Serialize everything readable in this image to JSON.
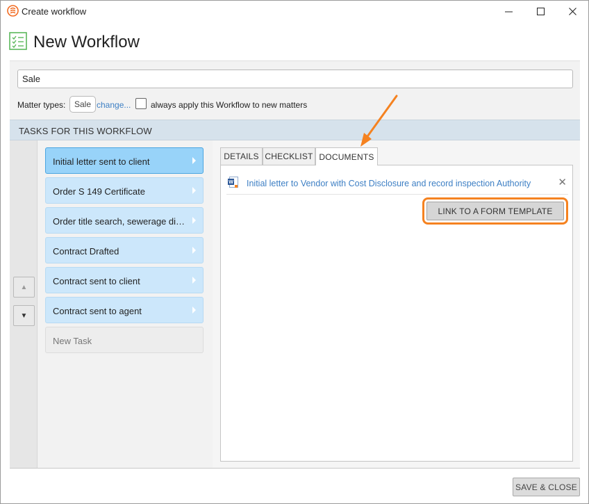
{
  "window": {
    "title": "Create workflow",
    "icons": {
      "app": "smokeball-logo-icon",
      "minimize": "minimize-icon",
      "maximize": "maximize-icon",
      "close": "close-icon"
    }
  },
  "header": {
    "title": "New Workflow",
    "icon": "checklist-icon"
  },
  "settings": {
    "workflow_name": "Sale",
    "matter_types_label": "Matter types:",
    "matter_type_chip": "Sale",
    "change_link": "change...",
    "always_apply_label": "always apply this Workflow to new matters",
    "always_apply_checked": false
  },
  "tasks_section": {
    "title": "TASKS FOR THIS WORKFLOW",
    "tasks": [
      {
        "label": "Initial letter sent to client",
        "selected": true
      },
      {
        "label": "Order S 149 Certificate"
      },
      {
        "label": "Order title search, sewerage diagram"
      },
      {
        "label": "Contract Drafted"
      },
      {
        "label": "Contract sent to client"
      },
      {
        "label": "Contract sent to agent"
      }
    ],
    "new_task_label": "New Task",
    "reorder_icons": {
      "up": "move-up-icon",
      "down": "move-down-icon"
    }
  },
  "tabs": [
    {
      "label": "DETAILS"
    },
    {
      "label": "CHECKLIST"
    },
    {
      "label": "DOCUMENTS",
      "active": true
    }
  ],
  "documents": {
    "items": [
      {
        "name": "Initial letter to Vendor with Cost Disclosure and record inspection Authority",
        "icon": "word-document-icon"
      }
    ],
    "link_template_button": "LINK TO A FORM TEMPLATE"
  },
  "footer": {
    "save_close_button": "SAVE & CLOSE"
  },
  "colors": {
    "accent": "#3d7fc4",
    "task_bg": "#cce7fb",
    "task_selected_bg": "#98d3f9",
    "highlight": "#f58220"
  }
}
